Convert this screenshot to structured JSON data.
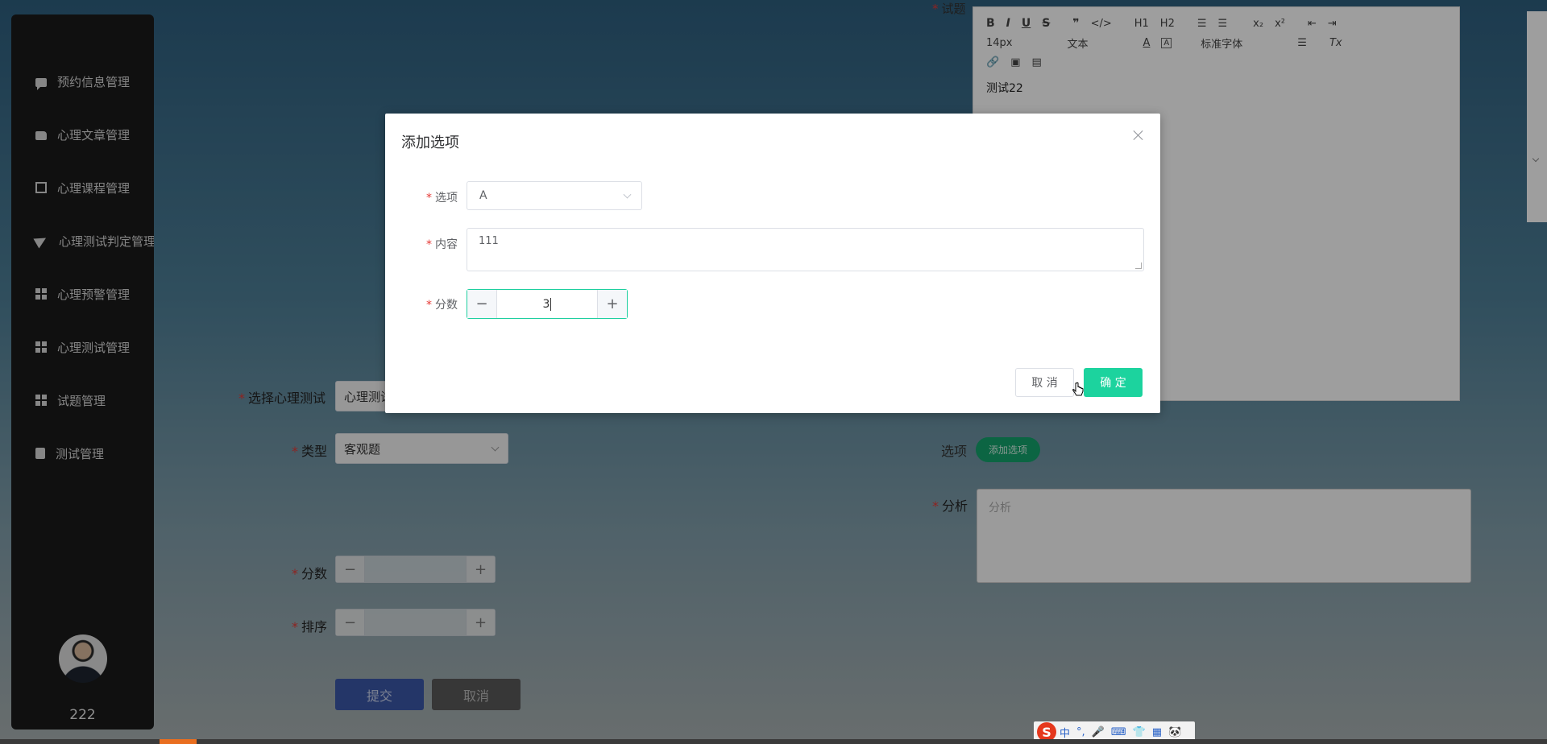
{
  "sidebar": {
    "items": [
      {
        "label": "预约信息管理",
        "icon": "comment-icon"
      },
      {
        "label": "心理文章管理",
        "icon": "thumbs-up-icon"
      },
      {
        "label": "心理课程管理",
        "icon": "chart-icon"
      },
      {
        "label": "心理测试判定管理",
        "icon": "paper-plane-icon"
      },
      {
        "label": "心理预警管理",
        "icon": "grid-icon"
      },
      {
        "label": "心理测试管理",
        "icon": "grid-icon"
      },
      {
        "label": "试题管理",
        "icon": "grid-icon"
      },
      {
        "label": "测试管理",
        "icon": "clipboard-icon"
      }
    ],
    "username": "222"
  },
  "form": {
    "question_label": "试题",
    "select_test_label": "选择心理测试",
    "select_test_value": "心理测试",
    "type_label": "类型",
    "type_value": "客观题",
    "score_label": "分数",
    "order_label": "排序",
    "submit_label": "提交",
    "cancel_label": "取消",
    "options_label": "选项",
    "add_option_label": "添加选项",
    "analysis_label": "分析",
    "analysis_placeholder": "分析"
  },
  "editor": {
    "font_size": "14px",
    "block_type": "文本",
    "font_family": "标准字体",
    "content": "测试22",
    "toolbar": {
      "bold": "B",
      "italic": "I",
      "underline": "U",
      "strike": "S",
      "quote": "❞",
      "code": "</>",
      "h1": "H1",
      "h2": "H2",
      "sub": "x₂",
      "sup": "x²",
      "color": "A",
      "bg": "A",
      "clear": "Tx"
    }
  },
  "modal": {
    "title": "添加选项",
    "option_label": "选项",
    "option_value": "A",
    "content_label": "内容",
    "content_value": "111",
    "score_label": "分数",
    "score_value": "3",
    "cancel_label": "取 消",
    "confirm_label": "确 定"
  },
  "ime": {
    "logo": "S",
    "items": [
      "中",
      "°,",
      "🎤",
      "⌨",
      "👕",
      "▦",
      "🐼"
    ]
  },
  "colors": {
    "accent": "#1cd39e",
    "sidebar_bg": "#1a1a1a",
    "submit_bg": "#3a57a8"
  }
}
